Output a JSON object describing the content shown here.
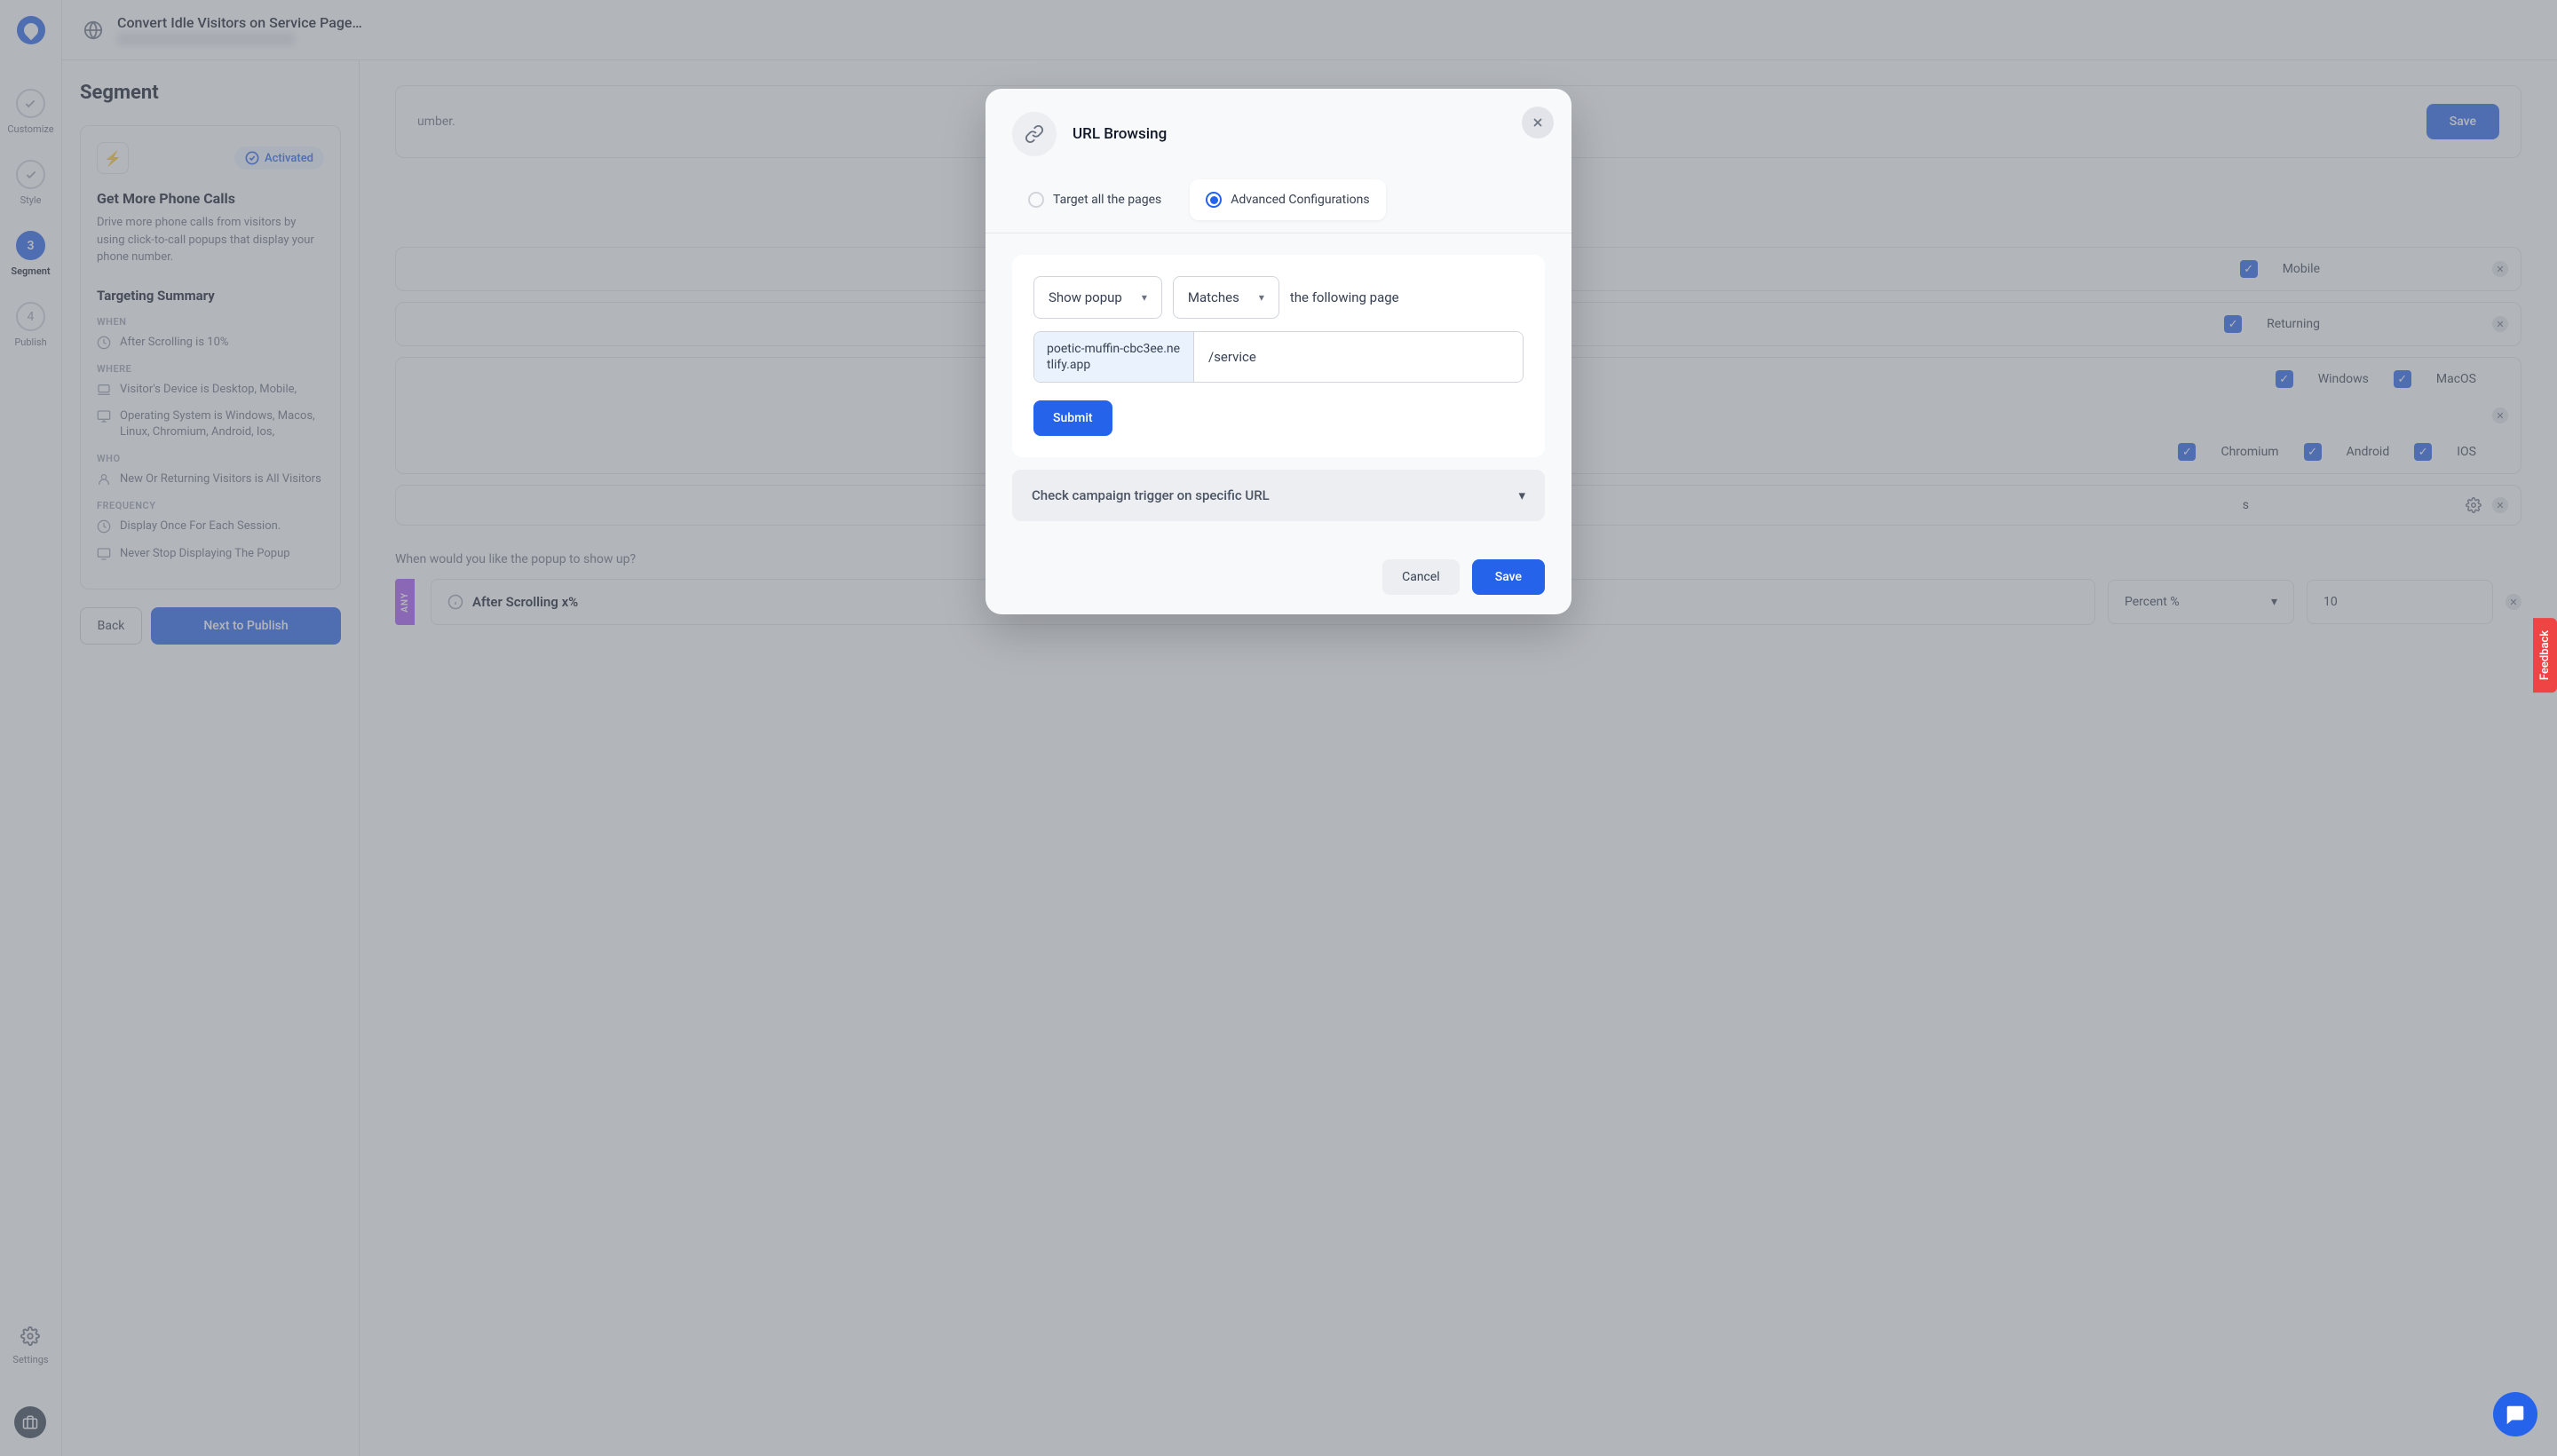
{
  "top": {
    "title": "Convert Idle Visitors on Service Page…"
  },
  "steps": {
    "customize": "Customize",
    "style": "Style",
    "segment_num": "3",
    "segment": "Segment",
    "publish_num": "4",
    "publish": "Publish",
    "settings": "Settings"
  },
  "panel": {
    "title": "Segment",
    "activated": "Activated",
    "card_title": "Get More Phone Calls",
    "card_desc": "Drive more phone calls from visitors by using click-to-call popups that display your phone number.",
    "targeting_h": "Targeting Summary",
    "when_h": "WHEN",
    "when_1": "After Scrolling is 10%",
    "where_h": "WHERE",
    "where_1": "Visitor's Device is Desktop, Mobile,",
    "where_2": "Operating System is Windows, Macos, Linux, Chromium, Android, Ios,",
    "who_h": "WHO",
    "who_1": "New Or Returning Visitors is All Visitors",
    "freq_h": "FREQUENCY",
    "freq_1": "Display Once For Each Session.",
    "freq_2": "Never Stop Displaying The Popup",
    "back": "Back",
    "next": "Next to Publish"
  },
  "main": {
    "hero_suffix": "umber.",
    "save": "Save",
    "mobile": "Mobile",
    "returning": "Returning",
    "windows": "Windows",
    "macos": "MacOS",
    "chromium": "Chromium",
    "android": "Android",
    "ios": "IOS",
    "s_letter": "s",
    "when_q": "When would you like the popup to show up?",
    "any": "ANY",
    "after_scroll": "After Scrolling x%",
    "unit": "Percent %",
    "value": "10"
  },
  "modal": {
    "title": "URL Browsing",
    "tab_all": "Target all the pages",
    "tab_adv": "Advanced Configurations",
    "show_popup": "Show popup",
    "matches": "Matches",
    "following": "the following page",
    "domain": "poetic-muffin-cbc3ee.netlify.app",
    "path": "/service",
    "submit": "Submit",
    "trigger": "Check campaign trigger on specific URL",
    "cancel": "Cancel",
    "save": "Save"
  },
  "misc": {
    "feedback": "Feedback"
  }
}
